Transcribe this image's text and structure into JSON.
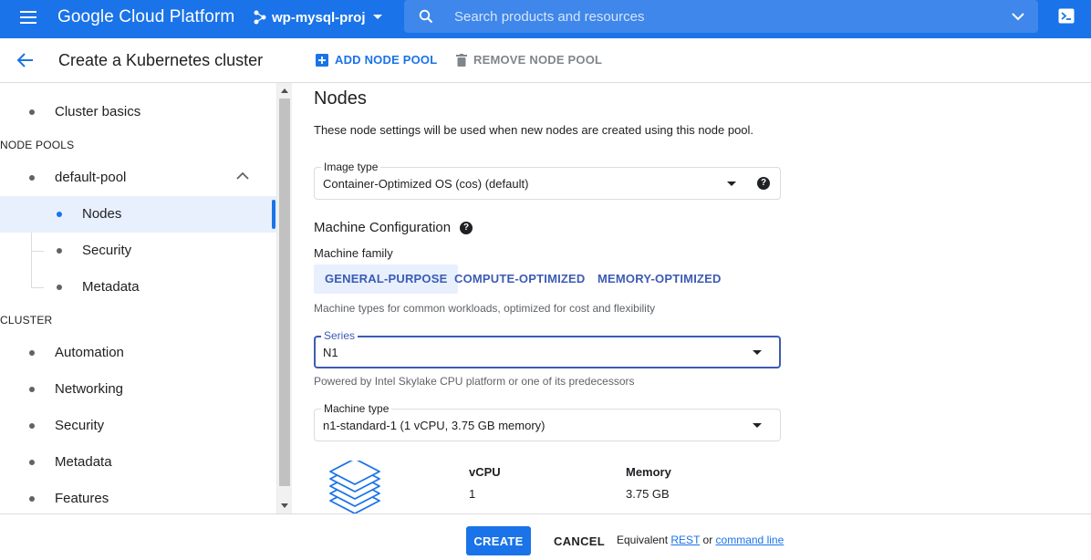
{
  "topbar": {
    "brand": "Google Cloud Platform",
    "project": "wp-mysql-proj",
    "search_placeholder": "Search products and resources"
  },
  "header": {
    "title": "Create a Kubernetes cluster",
    "add_node_pool": "ADD NODE POOL",
    "remove_node_pool": "REMOVE NODE POOL"
  },
  "sidebar": {
    "cluster_basics": "Cluster basics",
    "node_pools_header": "NODE POOLS",
    "pool_name": "default-pool",
    "pool_items": [
      "Nodes",
      "Security",
      "Metadata"
    ],
    "cluster_header": "CLUSTER",
    "cluster_items": [
      "Automation",
      "Networking",
      "Security",
      "Metadata",
      "Features"
    ],
    "selected": "Nodes"
  },
  "main": {
    "title": "Nodes",
    "description": "These node settings will be used when new nodes are created using this node pool.",
    "image_type": {
      "label": "Image type",
      "value": "Container-Optimized OS (cos) (default)"
    },
    "machine_config_title": "Machine Configuration",
    "machine_family_label": "Machine family",
    "families": [
      "GENERAL-PURPOSE",
      "COMPUTE-OPTIMIZED",
      "MEMORY-OPTIMIZED"
    ],
    "active_family": "GENERAL-PURPOSE",
    "family_hint": "Machine types for common workloads, optimized for cost and flexibility",
    "series": {
      "label": "Series",
      "value": "N1"
    },
    "series_hint": "Powered by Intel Skylake CPU platform or one of its predecessors",
    "machine_type": {
      "label": "Machine type",
      "value": "n1-standard-1 (1 vCPU, 3.75 GB memory)"
    },
    "specs": {
      "vcpu_label": "vCPU",
      "vcpu_value": "1",
      "memory_label": "Memory",
      "memory_value": "3.75 GB"
    }
  },
  "footer": {
    "create": "CREATE",
    "cancel": "CANCEL",
    "equivalent": "Equivalent",
    "rest": "REST",
    "or": "or",
    "command_line": "command line"
  },
  "colors": {
    "topbar": "#1a73e8",
    "accent": "#1a73e8",
    "selected_bg": "#e8f0fe",
    "focus_border": "#3c5bb5"
  }
}
